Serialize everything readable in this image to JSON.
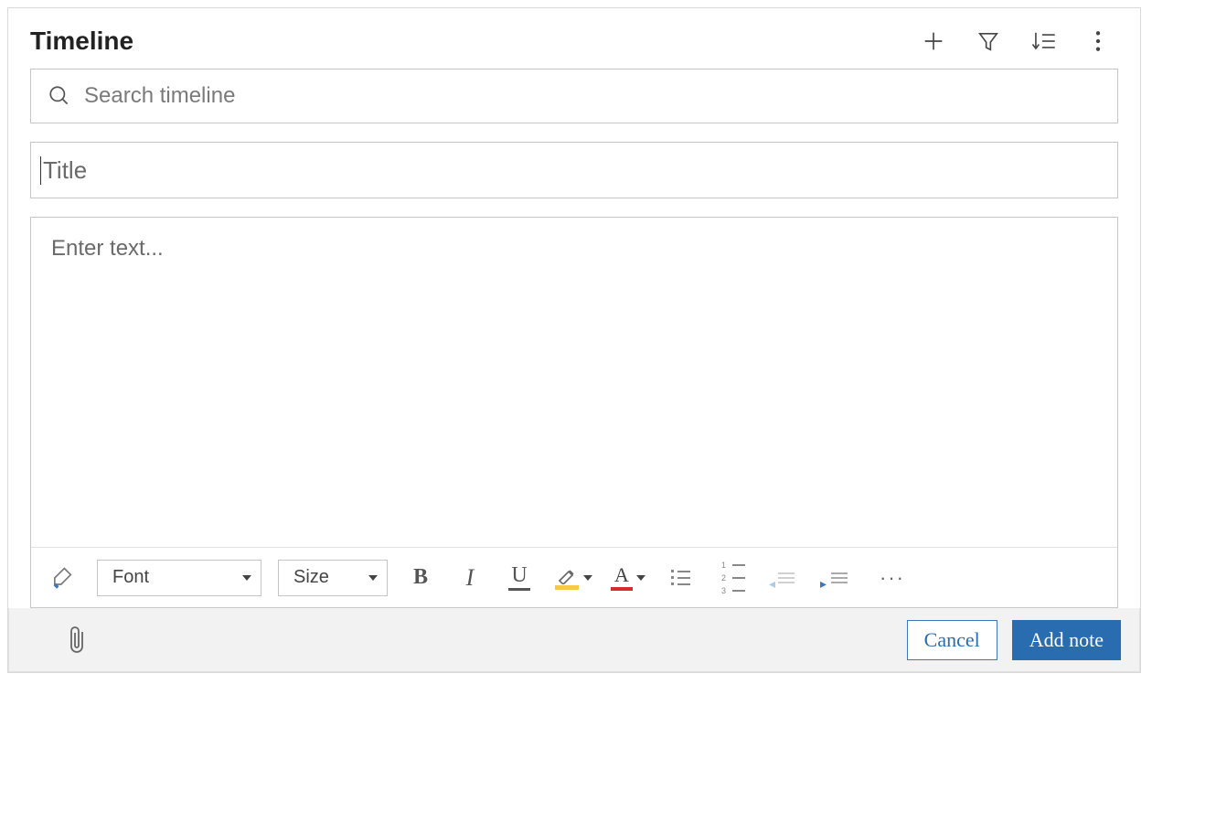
{
  "header": {
    "title": "Timeline"
  },
  "search": {
    "placeholder": "Search timeline",
    "value": ""
  },
  "title_field": {
    "placeholder": "Title",
    "value": ""
  },
  "editor": {
    "placeholder": "Enter text...",
    "value": ""
  },
  "toolbar": {
    "font_label": "Font",
    "size_label": "Size",
    "bold": "B",
    "italic": "I",
    "underline": "U",
    "font_color_letter": "A",
    "more": "···"
  },
  "footer": {
    "cancel_label": "Cancel",
    "submit_label": "Add note"
  },
  "colors": {
    "highlight": "#f7c948",
    "font_color": "#d92b2b",
    "primary": "#2a6cb0"
  }
}
